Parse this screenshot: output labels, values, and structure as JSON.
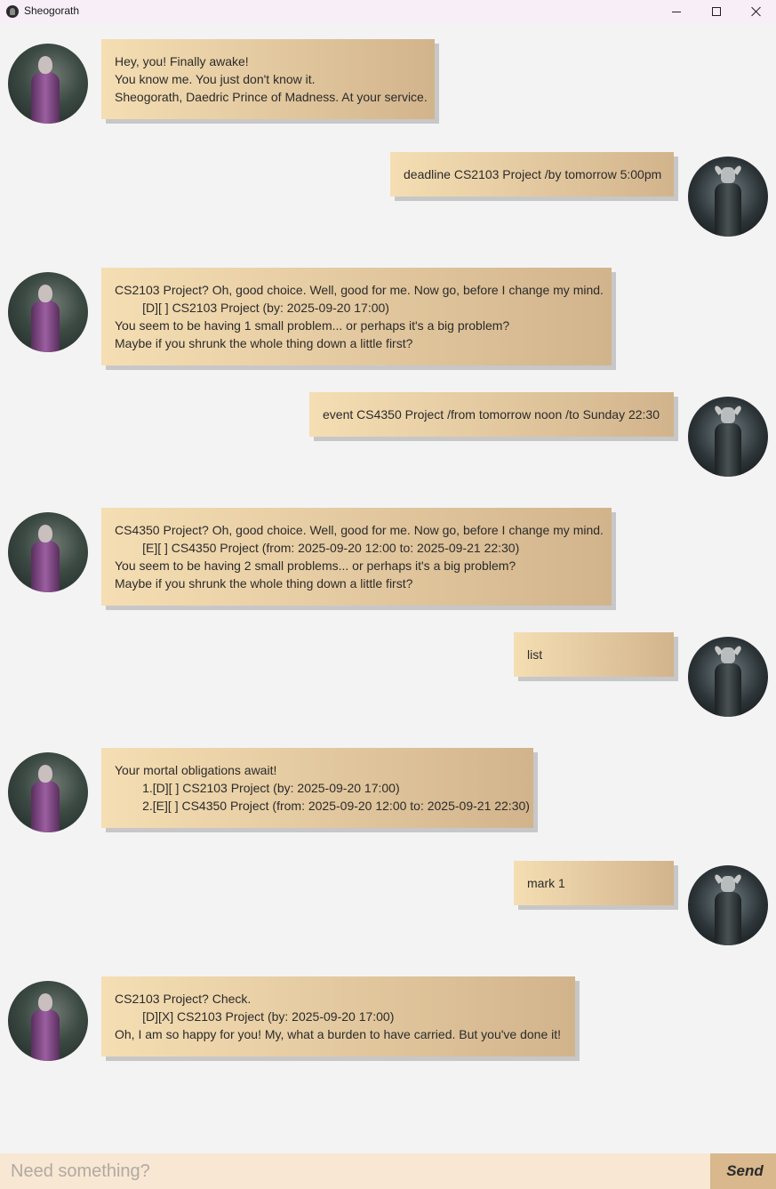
{
  "window": {
    "title": "Sheogorath",
    "icon": "sheogorath-icon"
  },
  "messages": [
    {
      "sender": "bot",
      "lines": [
        "Hey, you! Finally awake!",
        "You know me. You just don't know it.",
        "Sheogorath, Daedric Prince of Madness. At your service."
      ]
    },
    {
      "sender": "user",
      "lines": [
        "deadline CS2103 Project /by tomorrow 5:00pm"
      ]
    },
    {
      "sender": "bot",
      "lines": [
        "CS2103 Project? Oh, good choice. Well, good for me. Now go, before I change my mind.",
        "        [D][ ] CS2103 Project (by: 2025-09-20 17:00)",
        "You seem to be having 1 small problem... or perhaps it's a big problem?",
        "Maybe if you shrunk the whole thing down a little first?"
      ]
    },
    {
      "sender": "user",
      "lines": [
        "event CS4350 Project /from tomorrow noon /to Sunday 22:30"
      ]
    },
    {
      "sender": "bot",
      "lines": [
        "CS4350 Project? Oh, good choice. Well, good for me. Now go, before I change my mind.",
        "        [E][ ] CS4350 Project (from: 2025-09-20 12:00 to: 2025-09-21 22:30)",
        "You seem to be having 2 small problems... or perhaps it's a big problem?",
        "Maybe if you shrunk the whole thing down a little first?"
      ]
    },
    {
      "sender": "user",
      "lines": [
        "list"
      ]
    },
    {
      "sender": "bot",
      "lines": [
        "Your mortal obligations await!",
        "        1.[D][ ] CS2103 Project (by: 2025-09-20 17:00)",
        "        2.[E][ ] CS4350 Project (from: 2025-09-20 12:00 to: 2025-09-21 22:30)"
      ]
    },
    {
      "sender": "user",
      "lines": [
        "mark 1"
      ]
    },
    {
      "sender": "bot",
      "lines": [
        "CS2103 Project? Check.",
        "        [D][X] CS2103 Project (by: 2025-09-20 17:00)",
        "Oh, I am so happy for you! My, what a burden to have carried. But you've done it!"
      ]
    }
  ],
  "input": {
    "placeholder": "Need something?",
    "value": ""
  },
  "send_button": {
    "label": "Send"
  }
}
